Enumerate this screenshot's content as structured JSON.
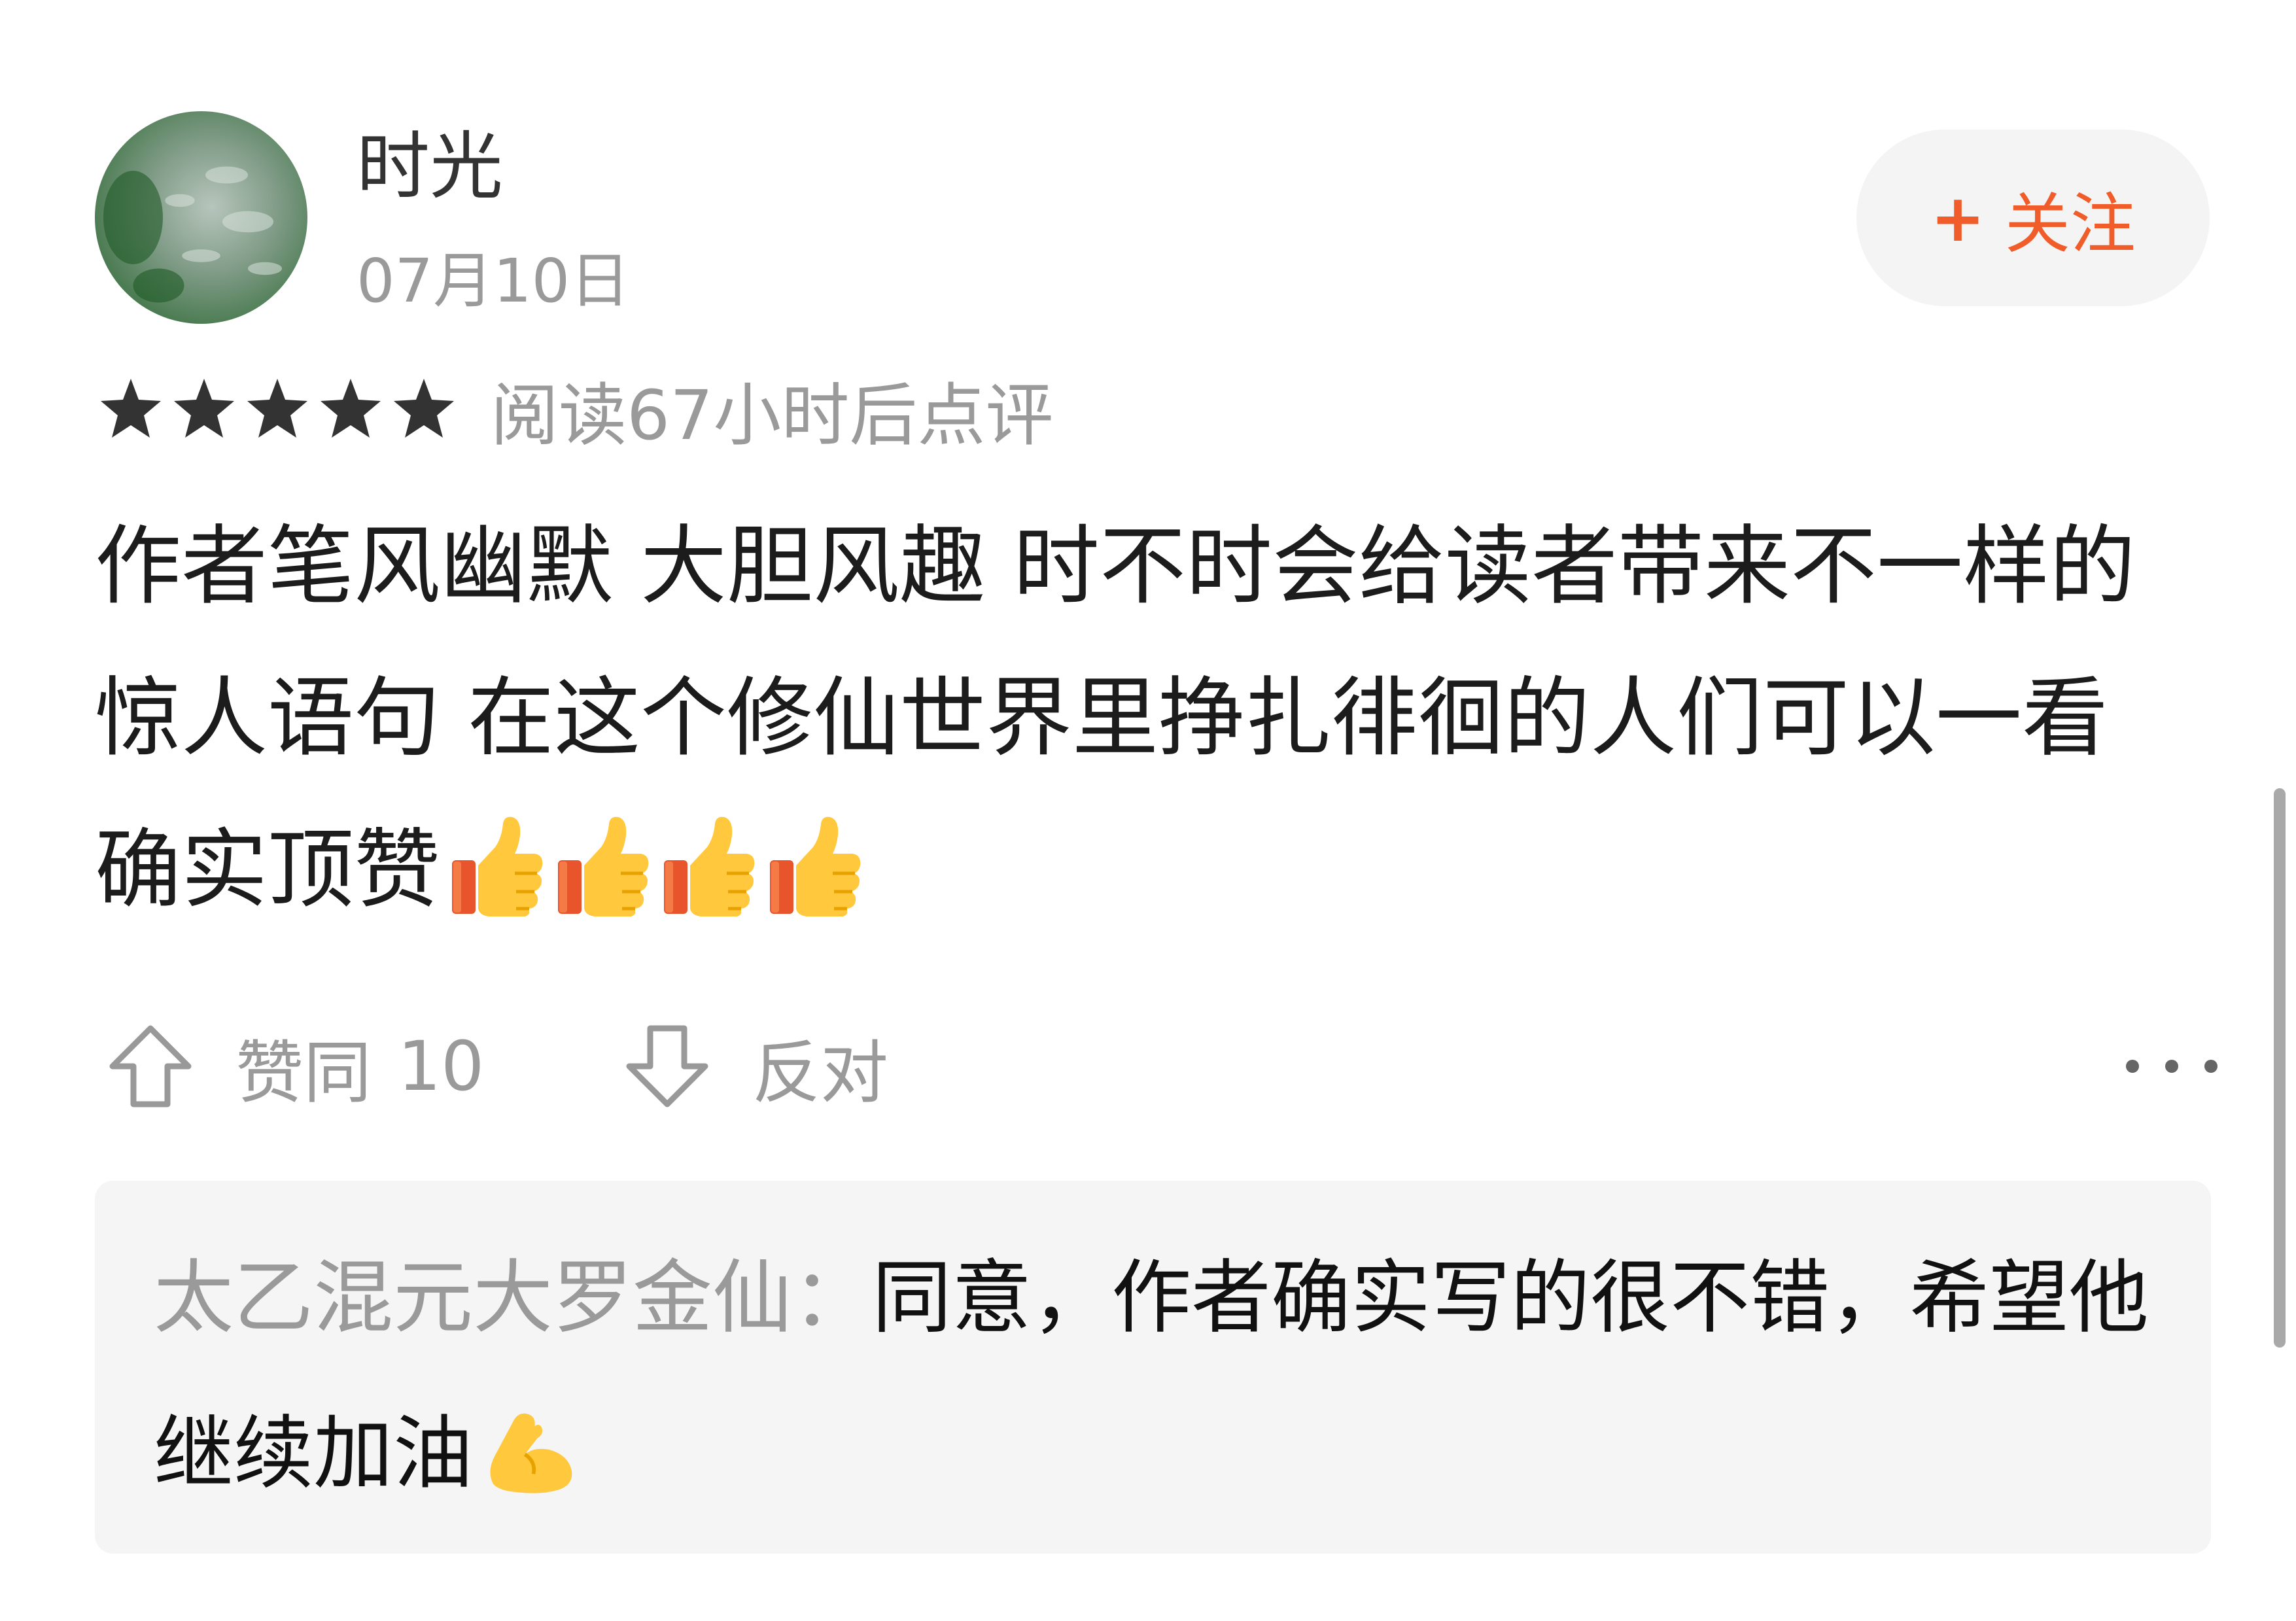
{
  "review": {
    "user": {
      "name": "时光",
      "date": "07月10日"
    },
    "follow_button": {
      "plus": "+",
      "label": "关注"
    },
    "rating": {
      "stars": 5,
      "max": 5,
      "read_note": "阅读67小时后点评"
    },
    "text": "作者笔风幽默 大胆风趣 时不时会给读者带来不一样的惊人语句 在这个修仙世界里挣扎徘徊的人们可以一看 确实顶赞",
    "trailing_emoji": [
      "thumbs-up",
      "thumbs-up",
      "thumbs-up",
      "thumbs-up"
    ],
    "actions": {
      "agree_label": "赞同",
      "agree_count": "10",
      "oppose_label": "反对"
    }
  },
  "reply": {
    "author": "太乙混元大罗金仙：",
    "text": "同意，作者确实写的很不错，希望他继续加油",
    "trailing_emoji": "flexed-biceps"
  },
  "colors": {
    "accent": "#f05d2a",
    "muted_text": "#9a9a9a",
    "body_text": "#1c1c1c",
    "reply_background": "#f5f5f5",
    "follow_background": "#f4f4f4"
  }
}
